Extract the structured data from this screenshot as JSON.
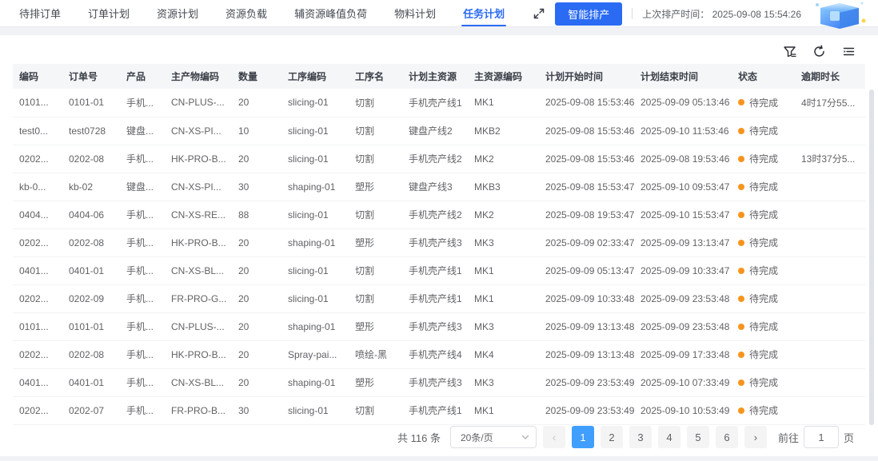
{
  "header": {
    "tabs": [
      {
        "label": "待排订单"
      },
      {
        "label": "订单计划"
      },
      {
        "label": "资源计划"
      },
      {
        "label": "资源负载"
      },
      {
        "label": "辅资源峰值负荷"
      },
      {
        "label": "物料计划"
      },
      {
        "label": "任务计划"
      }
    ],
    "active_tab": "任务计划",
    "smart_schedule_button": "智能排产",
    "last_schedule_label": "上次排产时间：",
    "last_schedule_time": "2025-09-08 15:54:26",
    "icons": [
      "fullscreen-icon"
    ]
  },
  "toolbar": {
    "icons": [
      "filter-icon",
      "refresh-icon",
      "column-settings-icon"
    ]
  },
  "table": {
    "columns": [
      "编码",
      "订单号",
      "产品",
      "主产物编码",
      "数量",
      "工序编码",
      "工序名",
      "计划主资源",
      "主资源编码",
      "计划开始时间",
      "计划结束时间",
      "状态",
      "逾期时长"
    ],
    "rows": [
      {
        "code": "0101...",
        "order_no": "0101-01",
        "product": "手机...",
        "item_code": "CN-PLUS-...",
        "qty": "20",
        "op_code": "slicing-01",
        "op_name": "切割",
        "resource": "手机壳产线1",
        "resource_code": "MK1",
        "start": "2025-09-08 15:53:46",
        "end": "2025-09-09 05:13:46",
        "status": "待完成",
        "overdue": "4时17分55..."
      },
      {
        "code": "test0...",
        "order_no": "test0728",
        "product": "键盘...",
        "item_code": "CN-XS-PI...",
        "qty": "10",
        "op_code": "slicing-01",
        "op_name": "切割",
        "resource": "键盘产线2",
        "resource_code": "MKB2",
        "start": "2025-09-08 15:53:46",
        "end": "2025-09-10 11:53:46",
        "status": "待完成",
        "overdue": ""
      },
      {
        "code": "0202...",
        "order_no": "0202-08",
        "product": "手机...",
        "item_code": "HK-PRO-B...",
        "qty": "20",
        "op_code": "slicing-01",
        "op_name": "切割",
        "resource": "手机壳产线2",
        "resource_code": "MK2",
        "start": "2025-09-08 15:53:46",
        "end": "2025-09-08 19:53:46",
        "status": "待完成",
        "overdue": "13时37分5..."
      },
      {
        "code": "kb-0...",
        "order_no": "kb-02",
        "product": "键盘...",
        "item_code": "CN-XS-PI...",
        "qty": "30",
        "op_code": "shaping-01",
        "op_name": "塑形",
        "resource": "键盘产线3",
        "resource_code": "MKB3",
        "start": "2025-09-08 15:53:47",
        "end": "2025-09-10 09:53:47",
        "status": "待完成",
        "overdue": ""
      },
      {
        "code": "0404...",
        "order_no": "0404-06",
        "product": "手机...",
        "item_code": "CN-XS-RE...",
        "qty": "88",
        "op_code": "slicing-01",
        "op_name": "切割",
        "resource": "手机壳产线2",
        "resource_code": "MK2",
        "start": "2025-09-08 19:53:47",
        "end": "2025-09-10 15:53:47",
        "status": "待完成",
        "overdue": ""
      },
      {
        "code": "0202...",
        "order_no": "0202-08",
        "product": "手机...",
        "item_code": "HK-PRO-B...",
        "qty": "20",
        "op_code": "shaping-01",
        "op_name": "塑形",
        "resource": "手机壳产线3",
        "resource_code": "MK3",
        "start": "2025-09-09 02:33:47",
        "end": "2025-09-09 13:13:47",
        "status": "待完成",
        "overdue": ""
      },
      {
        "code": "0401...",
        "order_no": "0401-01",
        "product": "手机...",
        "item_code": "CN-XS-BL...",
        "qty": "20",
        "op_code": "slicing-01",
        "op_name": "切割",
        "resource": "手机壳产线1",
        "resource_code": "MK1",
        "start": "2025-09-09 05:13:47",
        "end": "2025-09-09 10:33:47",
        "status": "待完成",
        "overdue": ""
      },
      {
        "code": "0202...",
        "order_no": "0202-09",
        "product": "手机...",
        "item_code": "FR-PRO-G...",
        "qty": "20",
        "op_code": "slicing-01",
        "op_name": "切割",
        "resource": "手机壳产线1",
        "resource_code": "MK1",
        "start": "2025-09-09 10:33:48",
        "end": "2025-09-09 23:53:48",
        "status": "待完成",
        "overdue": ""
      },
      {
        "code": "0101...",
        "order_no": "0101-01",
        "product": "手机...",
        "item_code": "CN-PLUS-...",
        "qty": "20",
        "op_code": "shaping-01",
        "op_name": "塑形",
        "resource": "手机壳产线3",
        "resource_code": "MK3",
        "start": "2025-09-09 13:13:48",
        "end": "2025-09-09 23:53:48",
        "status": "待完成",
        "overdue": ""
      },
      {
        "code": "0202...",
        "order_no": "0202-08",
        "product": "手机...",
        "item_code": "HK-PRO-B...",
        "qty": "20",
        "op_code": "Spray-pai...",
        "op_name": "喷绘-黑",
        "resource": "手机壳产线4",
        "resource_code": "MK4",
        "start": "2025-09-09 13:13:48",
        "end": "2025-09-09 17:33:48",
        "status": "待完成",
        "overdue": ""
      },
      {
        "code": "0401...",
        "order_no": "0401-01",
        "product": "手机...",
        "item_code": "CN-XS-BL...",
        "qty": "20",
        "op_code": "shaping-01",
        "op_name": "塑形",
        "resource": "手机壳产线3",
        "resource_code": "MK3",
        "start": "2025-09-09 23:53:49",
        "end": "2025-09-10 07:33:49",
        "status": "待完成",
        "overdue": ""
      },
      {
        "code": "0202...",
        "order_no": "0202-07",
        "product": "手机...",
        "item_code": "FR-PRO-B...",
        "qty": "30",
        "op_code": "slicing-01",
        "op_name": "切割",
        "resource": "手机壳产线1",
        "resource_code": "MK1",
        "start": "2025-09-09 23:53:49",
        "end": "2025-09-10 10:53:49",
        "status": "待完成",
        "overdue": ""
      }
    ]
  },
  "pagination": {
    "total_label": "共 116 条",
    "page_size": "20条/页",
    "pages": [
      "1",
      "2",
      "3",
      "4",
      "5",
      "6"
    ],
    "active_page": "1",
    "prev_icon": "‹",
    "next_icon": "›",
    "goto_label": "前往",
    "goto_value": "1",
    "goto_suffix": "页"
  },
  "colors": {
    "accent_blue": "#2b6bf3",
    "pagination_active": "#409eff",
    "status_dot_orange": "#f7941e",
    "table_header_bg": "#f5f6f8"
  }
}
